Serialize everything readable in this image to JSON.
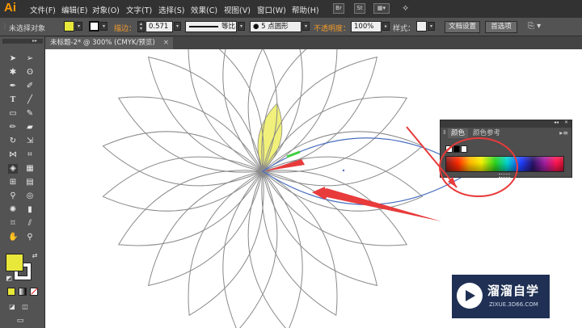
{
  "app": {
    "logo": "Ai"
  },
  "menubar": {
    "items": [
      "文件(F)",
      "编辑(E)",
      "对象(O)",
      "文字(T)",
      "选择(S)",
      "效果(C)",
      "视图(V)",
      "窗口(W)",
      "帮助(H)"
    ],
    "br_label": "Br",
    "st_label": "St"
  },
  "control_bar": {
    "selection_status": "未选择对象",
    "stroke_label": "描边：",
    "stroke_value": "0.571",
    "profile_label": "等比",
    "brush_label": "5 点圆形",
    "opacity_label": "不透明度：",
    "opacity_value": "100%",
    "style_label": "样式：",
    "doc_setup_button": "文档设置",
    "preferences_button": "首选项"
  },
  "document": {
    "tab_title": "未标题-2* @ 300% (CMYK/预览)",
    "close": "×"
  },
  "color_panel": {
    "tab_color": "颜色",
    "tab_color_guide": "颜色参考",
    "collapse": "◂◂",
    "close": "✕"
  },
  "watermark": {
    "brand": "溜溜自学",
    "url": "ZIXUE.3D66.COM"
  },
  "colors": {
    "fill_color": "#e8e83a",
    "ui_dark": "#535353",
    "menubar": "#323232",
    "annotation_red": "#e83b3b",
    "selection_blue": "#4a6fc0",
    "petal_stroke": "#8a8a8a",
    "highlight_petal": "#f0f07a"
  }
}
